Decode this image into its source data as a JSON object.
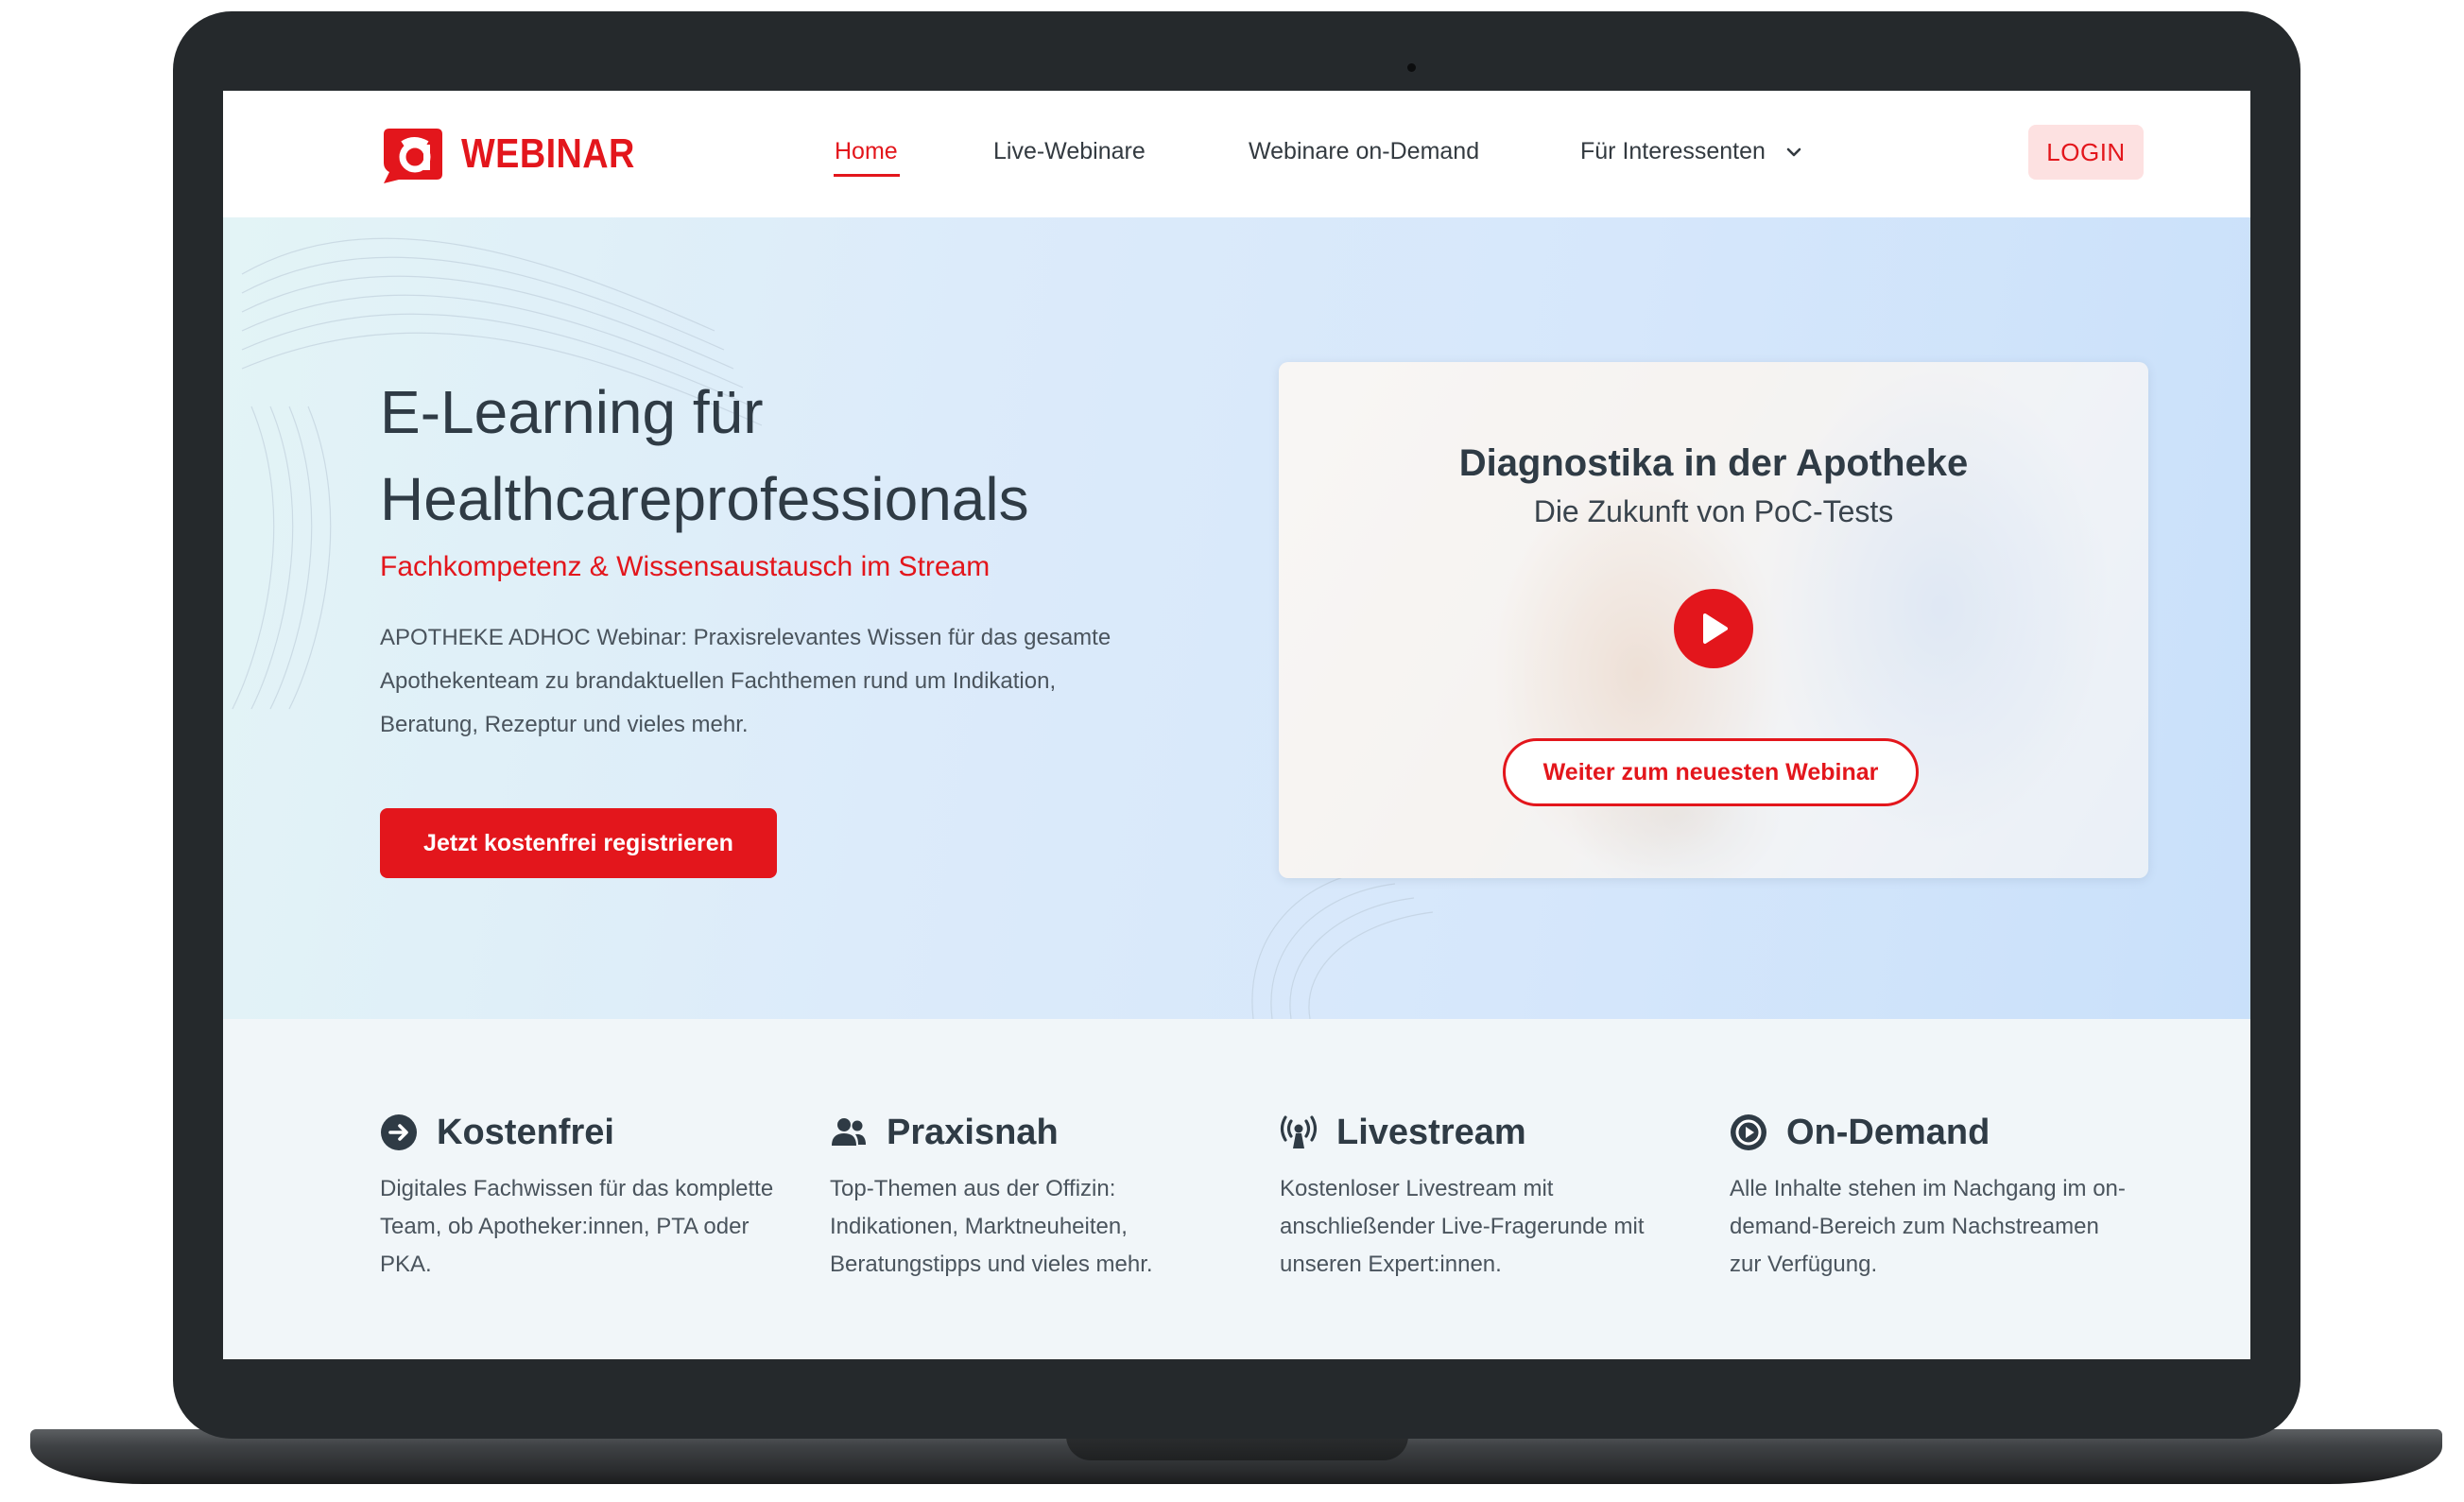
{
  "colors": {
    "brand_red": "#e3161c",
    "text_dark": "#2f3b45",
    "login_bg": "#fde1e1",
    "bezel": "#25292c"
  },
  "logo": {
    "mark_icon": "a-logo-icon",
    "text": "WEBINAR"
  },
  "nav": {
    "items": [
      {
        "label": "Home",
        "active": true
      },
      {
        "label": "Live-Webinare",
        "active": false
      },
      {
        "label": "Webinare on-Demand",
        "active": false
      },
      {
        "label": "Für Interessenten",
        "active": false,
        "icon": "chevron-down-icon"
      }
    ],
    "login_label": "LOGIN"
  },
  "hero": {
    "title_line1": "E-Learning für",
    "title_line2": "Healthcareprofessionals",
    "subtitle": "Fachkompetenz & Wissensaustausch im Stream",
    "text": "APOTHEKE ADHOC Webinar: Praxisrelevantes Wissen für das gesamte Apothekenteam zu brandaktuellen Fachthemen rund um Indikation, Beratung, Rezeptur und vieles mehr.",
    "cta_label": "Jetzt kostenfrei registrieren"
  },
  "video": {
    "title": "Diagnostika in der Apotheke",
    "subtitle": "Die Zukunft von PoC-Tests",
    "play_icon": "play-icon",
    "button_label": "Weiter zum neuesten Webinar"
  },
  "features": [
    {
      "icon": "arrow-right-circle-icon",
      "title": "Kostenfrei",
      "text": "Digitales Fachwissen für das komplette Team, ob Apotheker:innen, PTA oder PKA."
    },
    {
      "icon": "users-icon",
      "title": "Praxisnah",
      "text": "Top-Themen aus der Offizin: Indikationen, Marktneuheiten, Beratungstipps und vieles mehr."
    },
    {
      "icon": "broadcast-icon",
      "title": "Livestream",
      "text": "Kostenloser Livestream mit anschließender Live-Fragerunde mit unseren Expert:innen."
    },
    {
      "icon": "play-circle-icon",
      "title": "On-Demand",
      "text": "Alle Inhalte stehen im Nachgang im on-demand-Bereich zum Nachstreamen zur Verfügung."
    }
  ]
}
